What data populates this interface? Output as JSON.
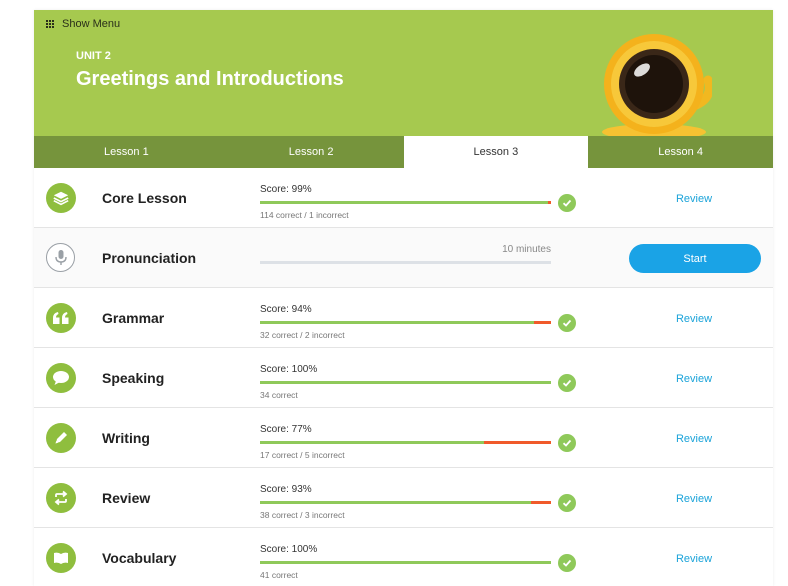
{
  "header": {
    "show_menu_label": "Show Menu",
    "unit_label": "UNIT 2",
    "unit_title": "Greetings and Introductions",
    "bg_color": "#a6c94f"
  },
  "tabs": [
    {
      "label": "Lesson 1",
      "active": false
    },
    {
      "label": "Lesson 2",
      "active": false
    },
    {
      "label": "Lesson 3",
      "active": true
    },
    {
      "label": "Lesson 4",
      "active": false
    }
  ],
  "colors": {
    "accent_green": "#8fc95a",
    "incorrect_red": "#f05a2a",
    "link_blue": "#1aa3d9",
    "start_blue": "#1aa3e6"
  },
  "lessons": [
    {
      "name": "Core Lesson",
      "icon": "layers-icon",
      "score": "Score: 99%",
      "detail": "114 correct / 1 incorrect",
      "correct_fraction": 0.99,
      "completed": true,
      "action": "Review"
    },
    {
      "name": "Pronunciation",
      "icon": "microphone-icon",
      "duration": "10 minutes",
      "correct_fraction": 0,
      "completed": false,
      "action": "Start"
    },
    {
      "name": "Grammar",
      "icon": "quote-icon",
      "score": "Score: 94%",
      "detail": "32 correct / 2 incorrect",
      "correct_fraction": 0.94,
      "completed": true,
      "action": "Review"
    },
    {
      "name": "Speaking",
      "icon": "speech-bubble-icon",
      "score": "Score: 100%",
      "detail": "34 correct",
      "correct_fraction": 1.0,
      "completed": true,
      "action": "Review"
    },
    {
      "name": "Writing",
      "icon": "pencil-icon",
      "score": "Score: 77%",
      "detail": "17 correct / 5 incorrect",
      "correct_fraction": 0.77,
      "completed": true,
      "action": "Review"
    },
    {
      "name": "Review",
      "icon": "repeat-icon",
      "score": "Score: 93%",
      "detail": "38 correct / 3 incorrect",
      "correct_fraction": 0.93,
      "completed": true,
      "action": "Review"
    },
    {
      "name": "Vocabulary",
      "icon": "book-icon",
      "score": "Score: 100%",
      "detail": "41 correct",
      "correct_fraction": 1.0,
      "completed": true,
      "action": "Review"
    }
  ]
}
